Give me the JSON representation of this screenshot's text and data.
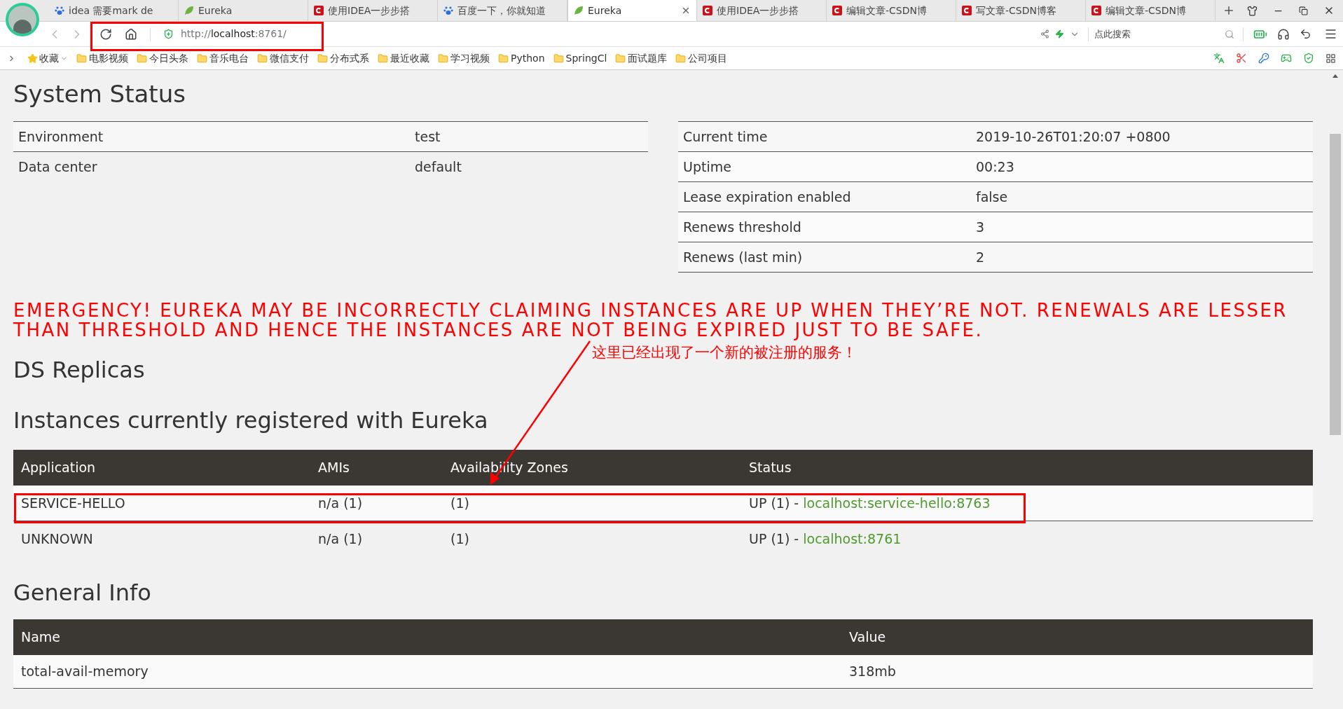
{
  "browser": {
    "tabs": [
      {
        "title": "idea 需要mark de",
        "kind": "paw",
        "selected": false
      },
      {
        "title": "Eureka",
        "kind": "leaf",
        "selected": false
      },
      {
        "title": "使用IDEA一步步搭",
        "kind": "csdn",
        "selected": false
      },
      {
        "title": "百度一下，你就知道",
        "kind": "paw",
        "selected": false
      },
      {
        "title": "Eureka",
        "kind": "leaf",
        "selected": true
      },
      {
        "title": "使用IDEA一步步搭",
        "kind": "csdn",
        "selected": false
      },
      {
        "title": "编辑文章-CSDN博",
        "kind": "csdn",
        "selected": false
      },
      {
        "title": "写文章-CSDN博客",
        "kind": "csdn",
        "selected": false
      },
      {
        "title": "编辑文章-CSDN博",
        "kind": "csdn",
        "selected": false
      }
    ],
    "address": "http://**localhost**:8761/",
    "search": {
      "placeholder": "点此搜索"
    },
    "favorites": "收藏",
    "bookmarks": [
      "电影视频",
      "今日头条",
      "音乐电台",
      "微信支付",
      "分布式系",
      "最近收藏",
      "学习视频",
      "Python",
      "SpringCl",
      "面试题库",
      "公司项目"
    ]
  },
  "system_status": {
    "title": "System Status",
    "left_rows": [
      {
        "name": "Environment",
        "value": "test"
      },
      {
        "name": "Data center",
        "value": "default"
      }
    ],
    "right_rows": [
      {
        "name": "Current time",
        "value": "2019-10-26T01:20:07 +0800"
      },
      {
        "name": "Uptime",
        "value": "00:23"
      },
      {
        "name": "Lease expiration enabled",
        "value": "false"
      },
      {
        "name": "Renews threshold",
        "value": "3"
      },
      {
        "name": "Renews (last min)",
        "value": "2"
      }
    ]
  },
  "emergency": "EMERGENCY! EUREKA MAY BE INCORRECTLY CLAIMING INSTANCES ARE UP WHEN THEY’RE NOT. RENEWALS ARE LESSER THAN THRESHOLD AND HENCE THE INSTANCES ARE NOT BEING EXPIRED JUST TO BE SAFE.",
  "ds_replicas": {
    "title": "DS Replicas"
  },
  "instances": {
    "title": "Instances currently registered with Eureka",
    "columns": [
      "Application",
      "AMIs",
      "Availability Zones",
      "Status"
    ],
    "rows": [
      {
        "application": "SERVICE-HELLO",
        "amis": "n/a (1)",
        "zones": "(1)",
        "status": "UP (1) - ",
        "link": "localhost:service-hello:8763"
      },
      {
        "application": "UNKNOWN",
        "amis": "n/a (1)",
        "zones": "(1)",
        "status": "UP (1) - ",
        "link": "localhost:8761"
      }
    ]
  },
  "general_info": {
    "title": "General Info",
    "columns": [
      "Name",
      "Value"
    ],
    "rows": [
      {
        "name": "total-avail-memory",
        "value": "318mb"
      }
    ]
  },
  "annotation": {
    "note": "这里已经出现了一个新的被注册的服务！"
  }
}
